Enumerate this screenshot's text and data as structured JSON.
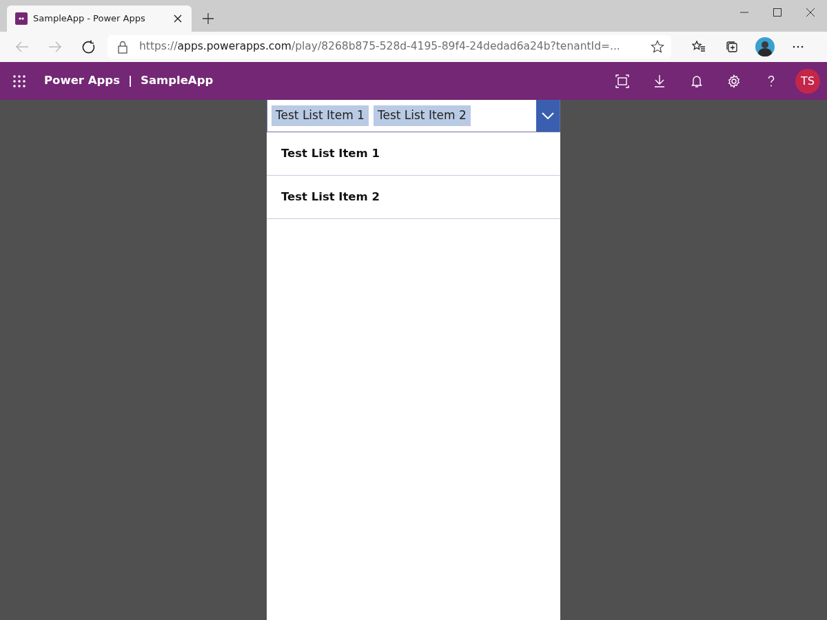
{
  "browser": {
    "tab": {
      "title": "SampleApp - Power Apps"
    },
    "address": {
      "scheme": "https://",
      "host": "apps.powerapps.com",
      "path": "/play/8268b875-528d-4195-89f4-24dedad6a24b?tenantId=..."
    }
  },
  "app_bar": {
    "product": "Power Apps",
    "separator": "|",
    "app_name": "SampleApp",
    "avatar": "TS"
  },
  "combo_box": {
    "tags": [
      "Test List Item 1",
      "Test List Item 2"
    ],
    "expanded": true
  },
  "dropdown_items": [
    "Test List Item 1",
    "Test List Item 2"
  ]
}
